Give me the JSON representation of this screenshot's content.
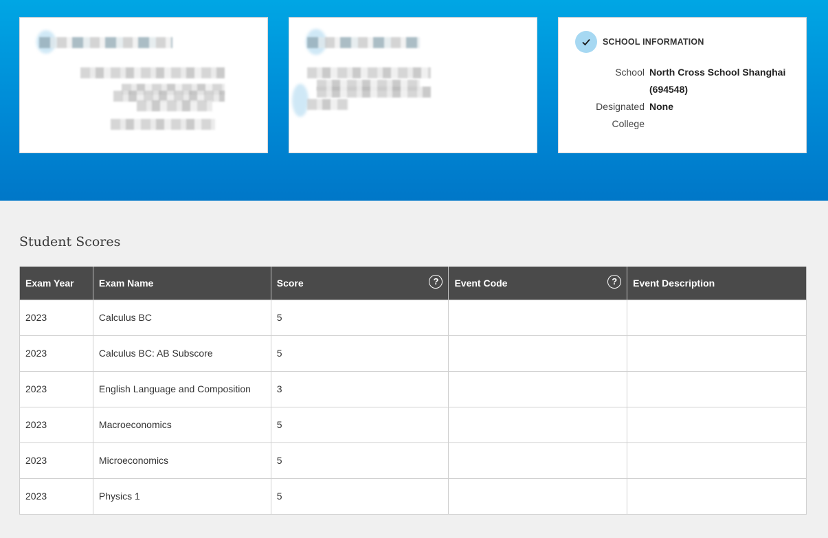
{
  "school_card": {
    "title": "SCHOOL INFORMATION",
    "fields": [
      {
        "label": "School",
        "value": "North Cross School Shanghai"
      },
      {
        "label": "",
        "value": "(694548)"
      },
      {
        "label": "Designated",
        "value": "None"
      },
      {
        "label": "College",
        "value": ""
      }
    ]
  },
  "scores": {
    "title": "Student Scores",
    "columns": [
      "Exam Year",
      "Exam Name",
      "Score",
      "Event Code",
      "Event Description"
    ],
    "help_icon_glyph": "?",
    "rows": [
      [
        "2023",
        "Calculus BC",
        "5",
        "",
        ""
      ],
      [
        "2023",
        "Calculus BC: AB Subscore",
        "5",
        "",
        ""
      ],
      [
        "2023",
        "English Language and Composition",
        "3",
        "",
        ""
      ],
      [
        "2023",
        "Macroeconomics",
        "5",
        "",
        ""
      ],
      [
        "2023",
        "Microeconomics",
        "5",
        "",
        ""
      ],
      [
        "2023",
        "Physics 1",
        "5",
        "",
        ""
      ]
    ]
  },
  "colors": {
    "hero_top": "#00a6e4",
    "hero_bottom": "#0077c8",
    "table_header": "#4a4a4a",
    "check_circle": "#a6d8f2"
  }
}
